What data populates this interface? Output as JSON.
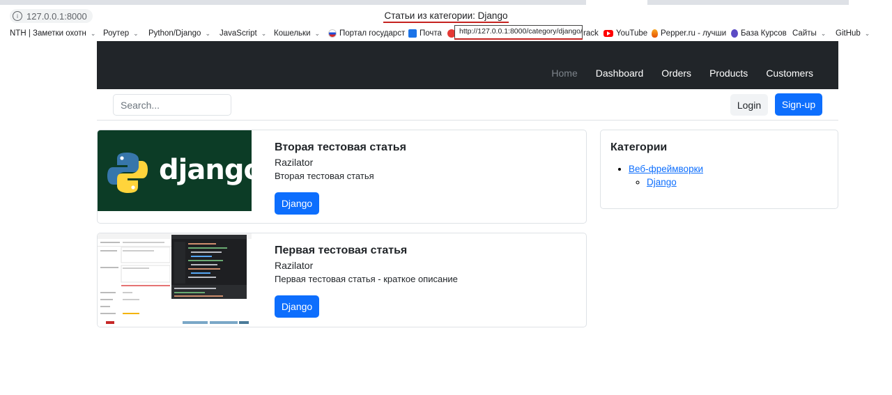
{
  "browser": {
    "url": "127.0.0.1:8000",
    "page_title": "Статьи из категории: Django",
    "status_url": "http://127.0.0.1:8000/category/django/",
    "bookmarks": [
      {
        "label": "NTH | Заметки охотн",
        "dropdown": true
      },
      {
        "label": "Роутер",
        "dropdown": true
      },
      {
        "label": "Python/Django",
        "dropdown": true
      },
      {
        "label": "JavaScript",
        "dropdown": true
      },
      {
        "label": "Кошельки",
        "dropdown": true
      },
      {
        "label": "Портал государст",
        "dropdown": false
      },
      {
        "label": "Почта",
        "dropdown": false
      },
      {
        "label": "rack",
        "dropdown": false
      },
      {
        "label": "YouTube",
        "dropdown": false
      },
      {
        "label": "Pepper.ru - лучши",
        "dropdown": false
      },
      {
        "label": "База Курсов",
        "dropdown": false
      },
      {
        "label": "Сайты",
        "dropdown": true
      },
      {
        "label": "GitHub",
        "dropdown": true
      }
    ]
  },
  "navbar": {
    "links": [
      "Home",
      "Dashboard",
      "Orders",
      "Products",
      "Customers"
    ]
  },
  "toolbar": {
    "search_placeholder": "Search...",
    "login_label": "Login",
    "signup_label": "Sign-up"
  },
  "articles": [
    {
      "title": "Вторая тестовая статья",
      "author": "Razilator",
      "description": "Вторая тестовая статья",
      "category": "Django",
      "thumb_logo_text": "django"
    },
    {
      "title": "Первая тестовая статья",
      "author": "Razilator",
      "description": "Первая тестовая статья - краткое описание",
      "category": "Django"
    }
  ],
  "sidebar": {
    "title": "Категории",
    "parent_category": "Веб-фреймворки",
    "child_category": "Django"
  },
  "colors": {
    "primary": "#0d6efd",
    "navbar_bg": "#212529",
    "django_green": "#0c3c26"
  }
}
